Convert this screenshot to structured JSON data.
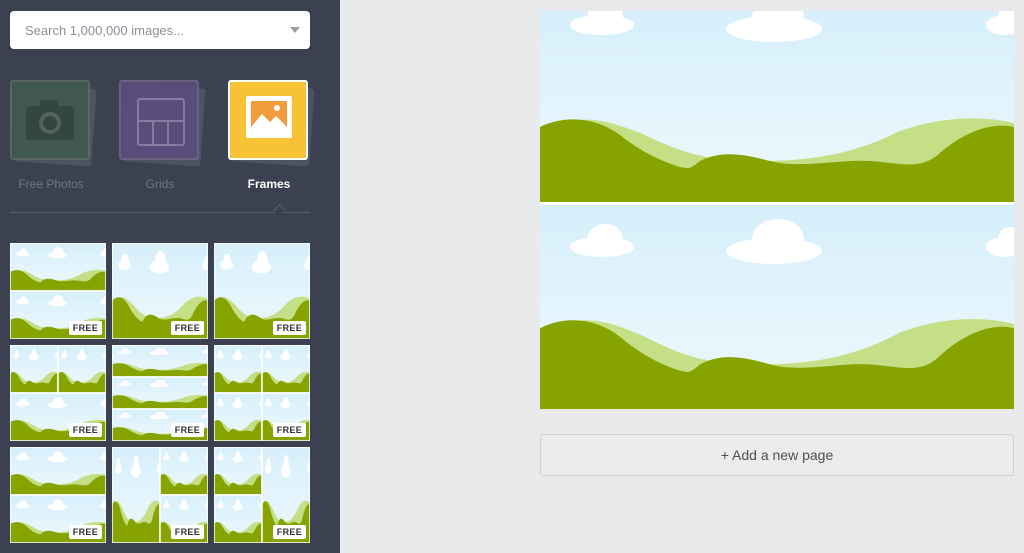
{
  "search": {
    "placeholder": "Search 1,000,000 images..."
  },
  "categories": [
    {
      "label": "Free Photos",
      "icon": "camera-icon",
      "active": false
    },
    {
      "label": "Grids",
      "icon": "grid-icon",
      "active": false
    },
    {
      "label": "Frames",
      "icon": "picture-frame-icon",
      "active": true
    }
  ],
  "thumbnails": [
    {
      "badge": "FREE"
    },
    {
      "badge": "FREE"
    },
    {
      "badge": "FREE"
    },
    {
      "badge": "FREE"
    },
    {
      "badge": "FREE"
    },
    {
      "badge": "FREE"
    },
    {
      "badge": "FREE"
    },
    {
      "badge": "FREE"
    },
    {
      "badge": "FREE"
    }
  ],
  "canvas": {
    "add_page_label": "+ Add a new page"
  },
  "colors": {
    "sidebar": "#3b4150",
    "sky": "#dff3fc",
    "hill_dark": "#86a300",
    "hill_light": "#c4df85",
    "frames_accent": "#f7c236"
  }
}
